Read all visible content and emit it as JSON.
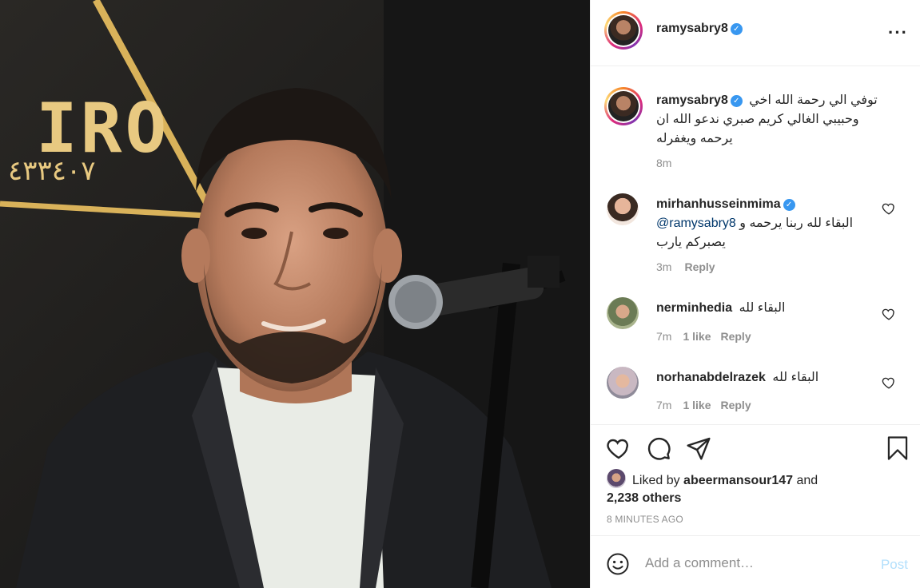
{
  "post": {
    "author": "ramysabry8",
    "more_icon": "more-horizontal-icon"
  },
  "caption": {
    "username": "ramysabry8",
    "line1": "توفي الي رحمة الله اخي",
    "line2": "وحبيبي الغالي كريم صبري ندعو الله ان",
    "line3": "يرحمه ويغفرله",
    "time": "8m"
  },
  "comments": [
    {
      "username": "mirhanhusseinmima",
      "verified": true,
      "text_line1": "البقاء لله ربنا يرحمه و",
      "mention": "@ramysabry8",
      "text_line2": "يصبركم يارب",
      "time": "3m",
      "likes": "",
      "reply": "Reply"
    },
    {
      "username": "nerminhedia",
      "verified": false,
      "text": "البقاء لله",
      "time": "7m",
      "likes": "1 like",
      "reply": "Reply"
    },
    {
      "username": "norhanabdelrazek",
      "verified": false,
      "text": "البقاء لله",
      "time": "7m",
      "likes": "1 like",
      "reply": "Reply"
    }
  ],
  "photo": {
    "sign_text": "IRO",
    "sign_subtext": "٤٣٣٤٠٧"
  },
  "likes": {
    "prefix": "Liked by",
    "user": "abeermansour147",
    "and": "and",
    "others": "2,238 others"
  },
  "time_ago": "8 MINUTES AGO",
  "add_comment": {
    "placeholder": "Add a comment…",
    "post_label": "Post"
  },
  "colors": {
    "verified": "#3897f0",
    "post_disabled": "#b2dffc",
    "muted": "#8e8e8e"
  }
}
